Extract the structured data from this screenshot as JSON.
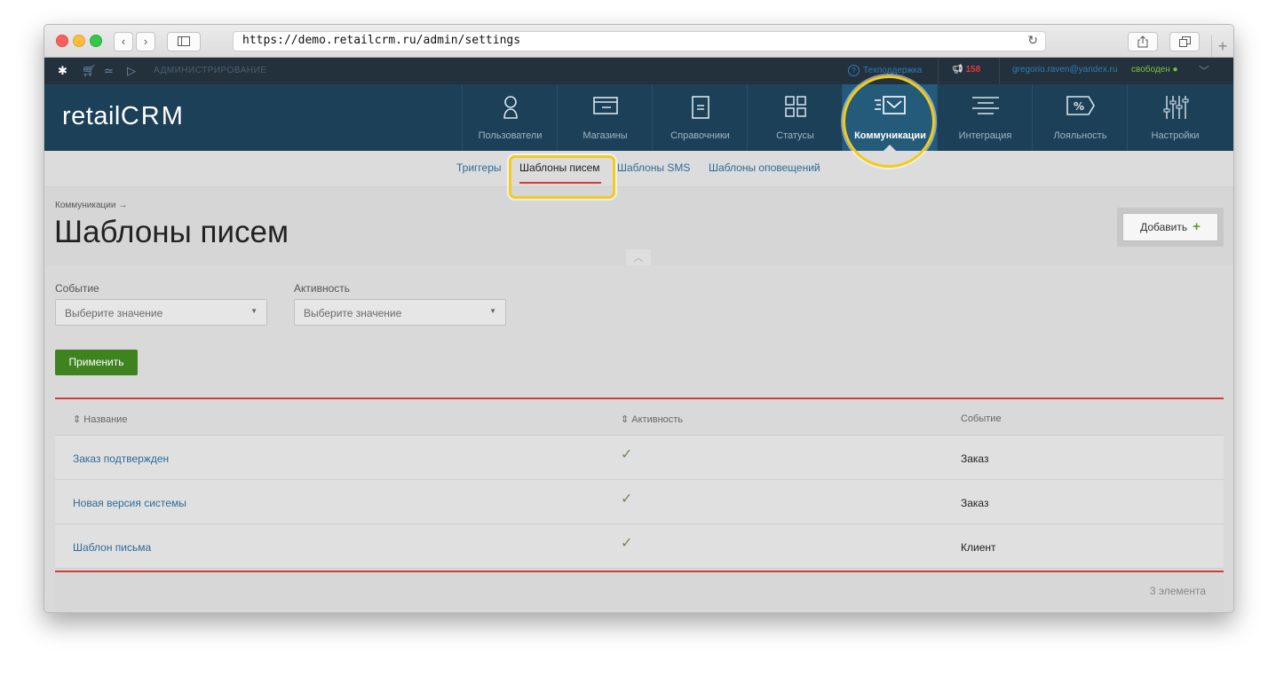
{
  "browser": {
    "url": "https://demo.retailcrm.ru/admin/settings",
    "nav_back": "‹",
    "nav_forward": "›"
  },
  "admin_bar": {
    "title": "АДМИНИСТРИРОВАНИЕ",
    "support": "Техподдержка",
    "notifications_count": "158",
    "user_email": "gregorio.raven@yandex.ru",
    "user_status": "свободен"
  },
  "logo": {
    "text_left": "retail",
    "text_right": "CRM"
  },
  "main_nav": [
    {
      "label": "Пользователи",
      "icon": "user-icon"
    },
    {
      "label": "Магазины",
      "icon": "store-icon"
    },
    {
      "label": "Справочники",
      "icon": "reference-icon"
    },
    {
      "label": "Статусы",
      "icon": "statuses-icon"
    },
    {
      "label": "Коммуникации",
      "icon": "communications-icon",
      "active": true
    },
    {
      "label": "Интеграция",
      "icon": "integration-icon"
    },
    {
      "label": "Лояльность",
      "icon": "loyalty-icon"
    },
    {
      "label": "Настройки",
      "icon": "settings-icon"
    }
  ],
  "sub_tabs": [
    {
      "label": "Триггеры"
    },
    {
      "label": "Шаблоны писем",
      "active": true
    },
    {
      "label": "Шаблоны SMS"
    },
    {
      "label": "Шаблоны оповещений"
    }
  ],
  "page": {
    "breadcrumb": "Коммуникации →",
    "title": "Шаблоны писем",
    "add_button": "Добавить"
  },
  "filters": {
    "event_label": "Событие",
    "event_value": "Выберите значение",
    "activity_label": "Активность",
    "activity_value": "Выберите значение",
    "apply_button": "Применить"
  },
  "table": {
    "columns": [
      "Название",
      "Активность",
      "Событие"
    ],
    "rows": [
      {
        "name": "Заказ подтвержден",
        "active": "✓",
        "event": "Заказ"
      },
      {
        "name": "Новая версия системы",
        "active": "✓",
        "event": "Заказ"
      },
      {
        "name": "Шаблон письма",
        "active": "✓",
        "event": "Клиент"
      }
    ],
    "footer_count": "3 элемента"
  },
  "colors": {
    "nav_bg": "#1c4057",
    "accent_red": "#d43b3b",
    "apply_green": "#3f8320",
    "highlight_yellow": "#f2cc1c"
  }
}
